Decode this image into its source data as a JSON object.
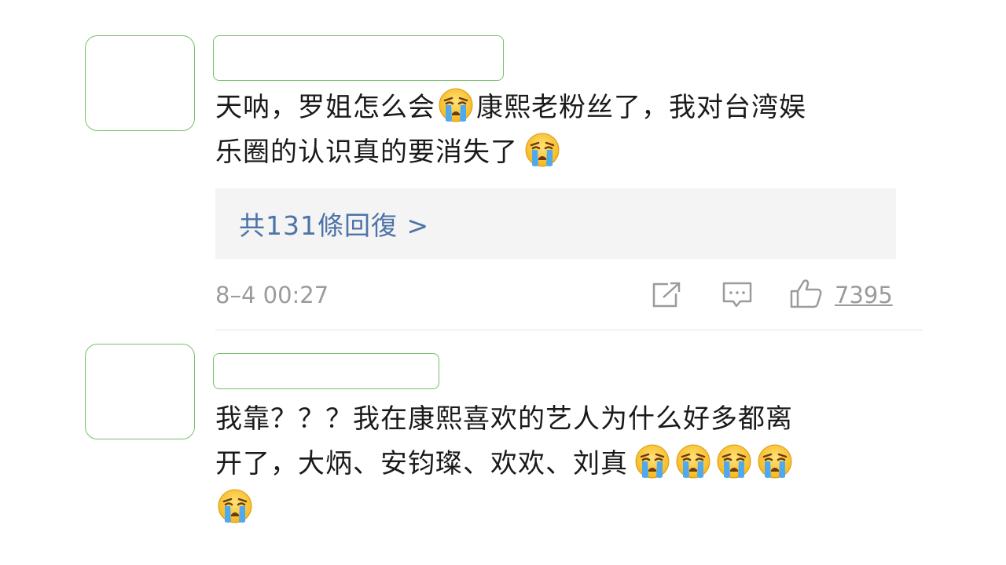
{
  "comments": [
    {
      "text_parts": [
        "天呐，罗姐怎么会",
        "康熙老粉丝了，我对台湾娱",
        "乐圈的认识真的要消失了"
      ],
      "emoji": "crying-face",
      "replies_label": "共131條回復 >",
      "timestamp": "8–4 00:27",
      "like_count": "7395"
    },
    {
      "text_parts": [
        "我靠？？？我在康熙喜欢的艺人为什么好多都离",
        "开了，大炳、安钧璨、欢欢、刘真"
      ],
      "emoji": "crying-face"
    }
  ],
  "icons": [
    "share-icon",
    "comment-icon",
    "thumbs-up-icon",
    "crying-face-icon"
  ],
  "colors": {
    "placeholder_border": "#77c26a",
    "link": "#4d73a8",
    "meta": "#9b9b9b",
    "reply_bg": "#f4f4f4",
    "text": "#1a1a1a"
  }
}
